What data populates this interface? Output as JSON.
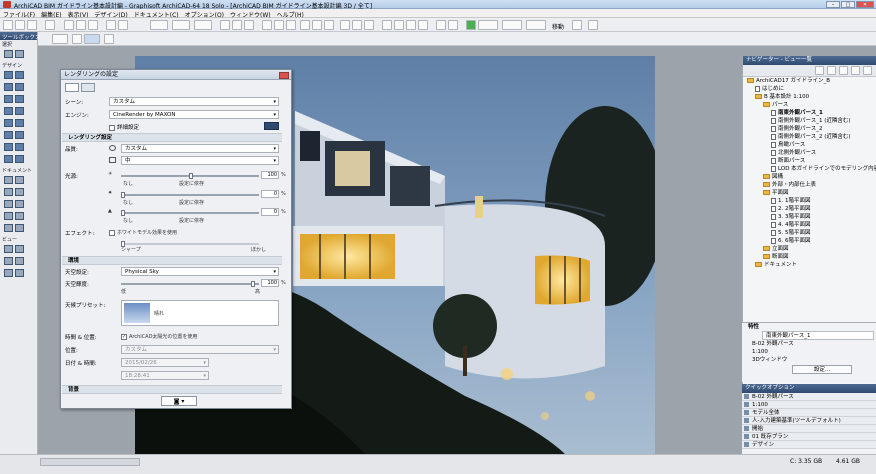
{
  "title": "ArchiCAD BIM ガイドライン基本設計編 - Graphisoft ArchiCAD-64 18 Solo - [ArchiCAD BIM ガイドライン基本設計編 3D / 全て]",
  "window_controls": [
    "–",
    "□",
    "✕"
  ],
  "menu": [
    "ファイル(F)",
    "編集(E)",
    "表示(V)",
    "デザイン(D)",
    "ドキュメント(C)",
    "オプション(O)",
    "ウィンドウ(W)",
    "ヘルプ(H)"
  ],
  "toolbar": {
    "move_label": "移動"
  },
  "toolbox": {
    "header": "ツールボックス",
    "select": "選択",
    "design": "デザイン",
    "document": "ドキュメント",
    "view": "ビュー"
  },
  "dialog": {
    "title": "レンダリングの設定",
    "scene_label": "シーン:",
    "scene_value": "カスタム",
    "engine_label": "エンジン:",
    "engine_value": "CineRender by MAXON",
    "detail_checkbox": "詳細設定",
    "section_render": "レンダリング設定",
    "quality_label": "品質:",
    "quality_value1": "カスタム",
    "quality_value2": "中",
    "light_label": "光源:",
    "light1": {
      "value": "100",
      "unit": "%",
      "min": "なし",
      "mid": "設定に依存"
    },
    "light2": {
      "value": "0",
      "unit": "%",
      "min": "なし",
      "mid": "設定に依存"
    },
    "light3": {
      "value": "0",
      "unit": "%",
      "min": "なし",
      "mid": "設定に依存"
    },
    "effects_label": "エフェクト:",
    "effects_check": "ホワイトモデル効果を使用",
    "sharp": "シャープ",
    "blur": "ぼかし",
    "section_env": "環境",
    "sky_label": "天空設定:",
    "sky_value": "Physical Sky",
    "sky_bright_label": "天空輝度:",
    "sky_bright_value": "100",
    "sky_bright_min": "低",
    "sky_bright_max": "高",
    "sky_preset_label": "天候プリセット:",
    "sky_preset_value": "晴れ",
    "time_label": "時間 & 位置:",
    "time_check": "ArchiCAD太陽光の位置を使用",
    "position_label": "位置:",
    "position_value": "カスタム",
    "date_label": "日付 & 時間:",
    "date_value": "2015/02/26",
    "time_value": "18:28:41",
    "section_bg": "背景"
  },
  "navigator": {
    "header": "ナビゲーター - ビュー一覧",
    "tree": [
      {
        "label": "ArchiCAD17 ガイドライン_B",
        "indent": 0,
        "icon": "fold"
      },
      {
        "label": "はじめに",
        "indent": 1,
        "icon": "sheet"
      },
      {
        "label": "B 基本設計 1:100",
        "indent": 1,
        "icon": "fold"
      },
      {
        "label": "パース",
        "indent": 2,
        "icon": "fold"
      },
      {
        "label": "南東外観パース_1",
        "indent": 3,
        "icon": "sheet"
      },
      {
        "label": "南側外観パース_1 (近隣含む)",
        "indent": 3,
        "icon": "sheet"
      },
      {
        "label": "南側外観パース_2",
        "indent": 3,
        "icon": "sheet"
      },
      {
        "label": "南側外観パース_2 (近隣含む)",
        "indent": 3,
        "icon": "sheet"
      },
      {
        "label": "鳥瞰パース",
        "indent": 3,
        "icon": "sheet"
      },
      {
        "label": "北側外観パース",
        "indent": 3,
        "icon": "sheet"
      },
      {
        "label": "断面パース",
        "indent": 3,
        "icon": "sheet"
      },
      {
        "label": "LOD 本ガイドラインでのモデリング内容",
        "indent": 3,
        "icon": "sheet"
      },
      {
        "label": "図構",
        "indent": 2,
        "icon": "fold"
      },
      {
        "label": "外部・内部仕上表",
        "indent": 2,
        "icon": "fold"
      },
      {
        "label": "平面図",
        "indent": 2,
        "icon": "fold"
      },
      {
        "label": "1. 1階平面図",
        "indent": 3,
        "icon": "sheet"
      },
      {
        "label": "2. 2階平面図",
        "indent": 3,
        "icon": "sheet"
      },
      {
        "label": "3. 3階平面図",
        "indent": 3,
        "icon": "sheet"
      },
      {
        "label": "4. 4階平面図",
        "indent": 3,
        "icon": "sheet"
      },
      {
        "label": "5. 5階平面図",
        "indent": 3,
        "icon": "sheet"
      },
      {
        "label": "6. 6階平面図",
        "indent": 3,
        "icon": "sheet"
      },
      {
        "label": "立面図",
        "indent": 2,
        "icon": "fold"
      },
      {
        "label": "断面図",
        "indent": 2,
        "icon": "fold"
      },
      {
        "label": "ドキュメント",
        "indent": 1,
        "icon": "fold"
      }
    ],
    "props_header": "特性",
    "props_name": "南東外観パース_1",
    "props_id": "B-02 外観パース",
    "props_scale": "1:100",
    "props_window": "3Dウィンドウ",
    "settings_button": "設定...",
    "qo_header": "クイックオプション",
    "qo_items": [
      "B-02 外観パース",
      "1:100",
      "モデル全体",
      "人-入力建築基準(ツールデフォルト)",
      "開始",
      "01 既存プラン",
      "デザイン"
    ]
  },
  "status": {
    "disk": "C: 3.35 GB",
    "mem": "4.61 GB"
  }
}
